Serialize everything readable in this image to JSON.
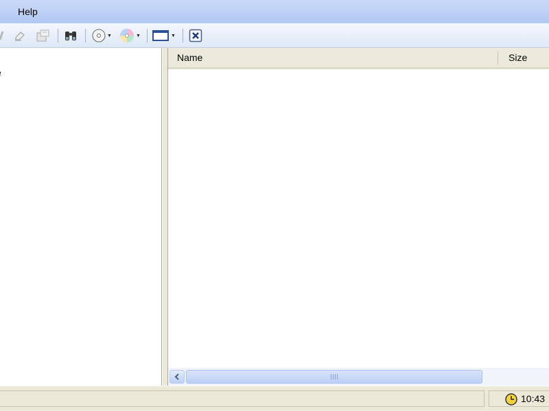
{
  "menubar": {
    "items": [
      {
        "label": "Help"
      }
    ]
  },
  "toolbar": {
    "buttons": [
      {
        "icon": "pencil-icon"
      },
      {
        "icon": "eraser-icon"
      },
      {
        "icon": "properties-icon"
      },
      {
        "icon": "binoculars-icon"
      },
      {
        "icon": "disc-icon"
      },
      {
        "icon": "color-disc-icon"
      },
      {
        "icon": "window-icon"
      },
      {
        "icon": "close-box-icon"
      }
    ]
  },
  "tree": {
    "items": [
      {
        "label": "e"
      }
    ]
  },
  "list": {
    "columns": [
      {
        "label": "Name"
      },
      {
        "label": "Size"
      }
    ],
    "rows": []
  },
  "statusbar": {
    "main_text": "",
    "clock": "10:43"
  }
}
